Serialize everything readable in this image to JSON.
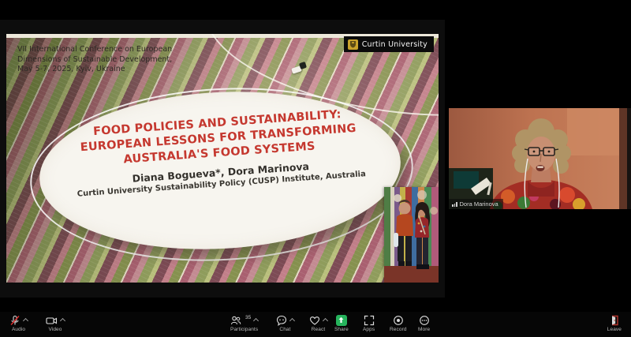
{
  "colors": {
    "title_red": "#c5382f",
    "share_green": "#26b35c",
    "leave_red": "#b6342c",
    "curtin_gold": "#c9a22c",
    "mute_slash_red": "#d92c2c"
  },
  "share_pane": {
    "conference_line1": "VII International Conference on European",
    "conference_line2": "Dimensions of Sustainable Development,",
    "conference_line3": "May 5-7, 2025, Kyiv, Ukraine",
    "logo_text": "Curtin University",
    "title_line1": "FOOD POLICIES AND SUSTAINABILITY:",
    "title_line2": "EUROPEAN LESSONS FOR TRANSFORMING",
    "title_line3": "AUSTRALIA'S FOOD SYSTEMS",
    "authors": "Diana Bogueva*, Dora Marinova",
    "affiliation": "Curtin University Sustainability Policy (CUSP) Institute, Australia"
  },
  "webcam": {
    "name": "Dora Marinova"
  },
  "toolbar": {
    "audio": {
      "label": "Audio"
    },
    "video": {
      "label": "Video"
    },
    "participants": {
      "label": "Participants",
      "count": "35"
    },
    "chat": {
      "label": "Chat"
    },
    "react": {
      "label": "React"
    },
    "share": {
      "label": "Share"
    },
    "apps": {
      "label": "Apps"
    },
    "record": {
      "label": "Record"
    },
    "more": {
      "label": "More"
    },
    "leave": {
      "label": "Leave"
    }
  }
}
